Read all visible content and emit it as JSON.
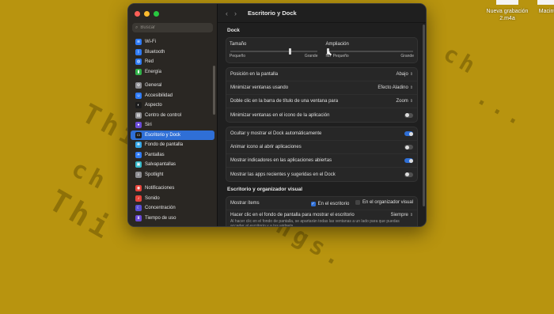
{
  "desktop": {
    "icons": [
      {
        "label_line1": "Nueva grabación",
        "label_line2": "2.m4a"
      },
      {
        "label_line1": "Macinto",
        "label_line2": ""
      }
    ],
    "wallpaper_text": [
      "Thi",
      "Thi",
      "ch",
      "ch",
      "ngs.",
      "..."
    ]
  },
  "window": {
    "title": "Escritorio y Dock",
    "search_placeholder": "Buscar"
  },
  "sidebar": {
    "groups": [
      [
        {
          "label": "Wi-Fi",
          "icon": "wifi-icon",
          "color": "#2f7bf6",
          "glyph": "≋"
        },
        {
          "label": "Bluetooth",
          "icon": "bluetooth-icon",
          "color": "#2f7bf6",
          "glyph": "ᛒ"
        },
        {
          "label": "Red",
          "icon": "globe-icon",
          "color": "#2f7bf6",
          "glyph": "◍"
        },
        {
          "label": "Energía",
          "icon": "battery-icon",
          "color": "#32b34a",
          "glyph": "▮"
        }
      ],
      [
        {
          "label": "General",
          "icon": "gear-icon",
          "color": "#8e8e93",
          "glyph": "⚙"
        },
        {
          "label": "Accesibilidad",
          "icon": "accessibility-icon",
          "color": "#2f7bf6",
          "glyph": "☺"
        },
        {
          "label": "Aspecto",
          "icon": "appearance-icon",
          "color": "#1c1c1c",
          "glyph": "◐"
        },
        {
          "label": "Centro de control",
          "icon": "control-center-icon",
          "color": "#8e8e93",
          "glyph": "▤"
        },
        {
          "label": "Siri",
          "icon": "siri-icon",
          "color": "#6b4bd8",
          "glyph": "●"
        },
        {
          "label": "Escritorio y Dock",
          "icon": "dock-icon",
          "color": "#1c1c1c",
          "glyph": "▭",
          "active": true
        },
        {
          "label": "Fondo de pantalla",
          "icon": "wallpaper-icon",
          "color": "#34a6e8",
          "glyph": "❋"
        },
        {
          "label": "Pantallas",
          "icon": "display-icon",
          "color": "#2f7bf6",
          "glyph": "☀"
        },
        {
          "label": "Salvapantallas",
          "icon": "screensaver-icon",
          "color": "#36b9c9",
          "glyph": "▣"
        },
        {
          "label": "Spotlight",
          "icon": "spotlight-icon",
          "color": "#8e8e93",
          "glyph": "⌕"
        }
      ],
      [
        {
          "label": "Notificaciones",
          "icon": "notifications-icon",
          "color": "#e8453c",
          "glyph": "◉"
        },
        {
          "label": "Sonido",
          "icon": "sound-icon",
          "color": "#e8453c",
          "glyph": "♪"
        },
        {
          "label": "Concentración",
          "icon": "focus-icon",
          "color": "#5b4fd6",
          "glyph": "☾"
        },
        {
          "label": "Tiempo de uso",
          "icon": "screen-time-icon",
          "color": "#6b4bd8",
          "glyph": "⧗"
        }
      ]
    ]
  },
  "dock": {
    "section_title": "Dock",
    "size": {
      "label": "Tamaño",
      "min": "Pequeño",
      "max": "Grande",
      "value": 0.68
    },
    "magnification": {
      "label": "Ampliación",
      "min": "No",
      "min2": "Pequeño",
      "max": "Grande",
      "value": 0.0
    },
    "rows1": [
      {
        "label": "Posición en la pantalla",
        "value": "Abajo",
        "control": "popup"
      },
      {
        "label": "Minimizar ventanas usando",
        "value": "Efecto Aladino",
        "control": "popup"
      },
      {
        "label": "Doble clic en la barra de título de una ventana para",
        "value": "Zoom",
        "control": "popup"
      },
      {
        "label": "Minimizar ventanas en el icono de la aplicación",
        "value": "off",
        "control": "toggle"
      }
    ],
    "rows2": [
      {
        "label": "Ocultar y mostrar el Dock automáticamente",
        "value": "on",
        "control": "toggle"
      },
      {
        "label": "Animar icono al abrir aplicaciones",
        "value": "off",
        "control": "toggle"
      },
      {
        "label": "Mostrar indicadores en las aplicaciones abiertas",
        "value": "on",
        "control": "toggle"
      },
      {
        "label": "Mostrar las apps recientes y sugeridas en el Dock",
        "value": "off",
        "control": "toggle"
      }
    ]
  },
  "stage": {
    "section_title": "Escritorio y organizador visual",
    "show_items_label": "Mostrar ítems",
    "opt_desktop": "En el escritorio",
    "opt_organizer": "En el organizador visual",
    "click_label": "Hacer clic en el fondo de pantalla para mostrar el escritorio",
    "click_value": "Siempre",
    "click_note": "Al hacer clic en el fondo de pantalla, se apartarán todas las ventanas a un lado para que puedas acceder al escritorio y a tus widgets."
  }
}
